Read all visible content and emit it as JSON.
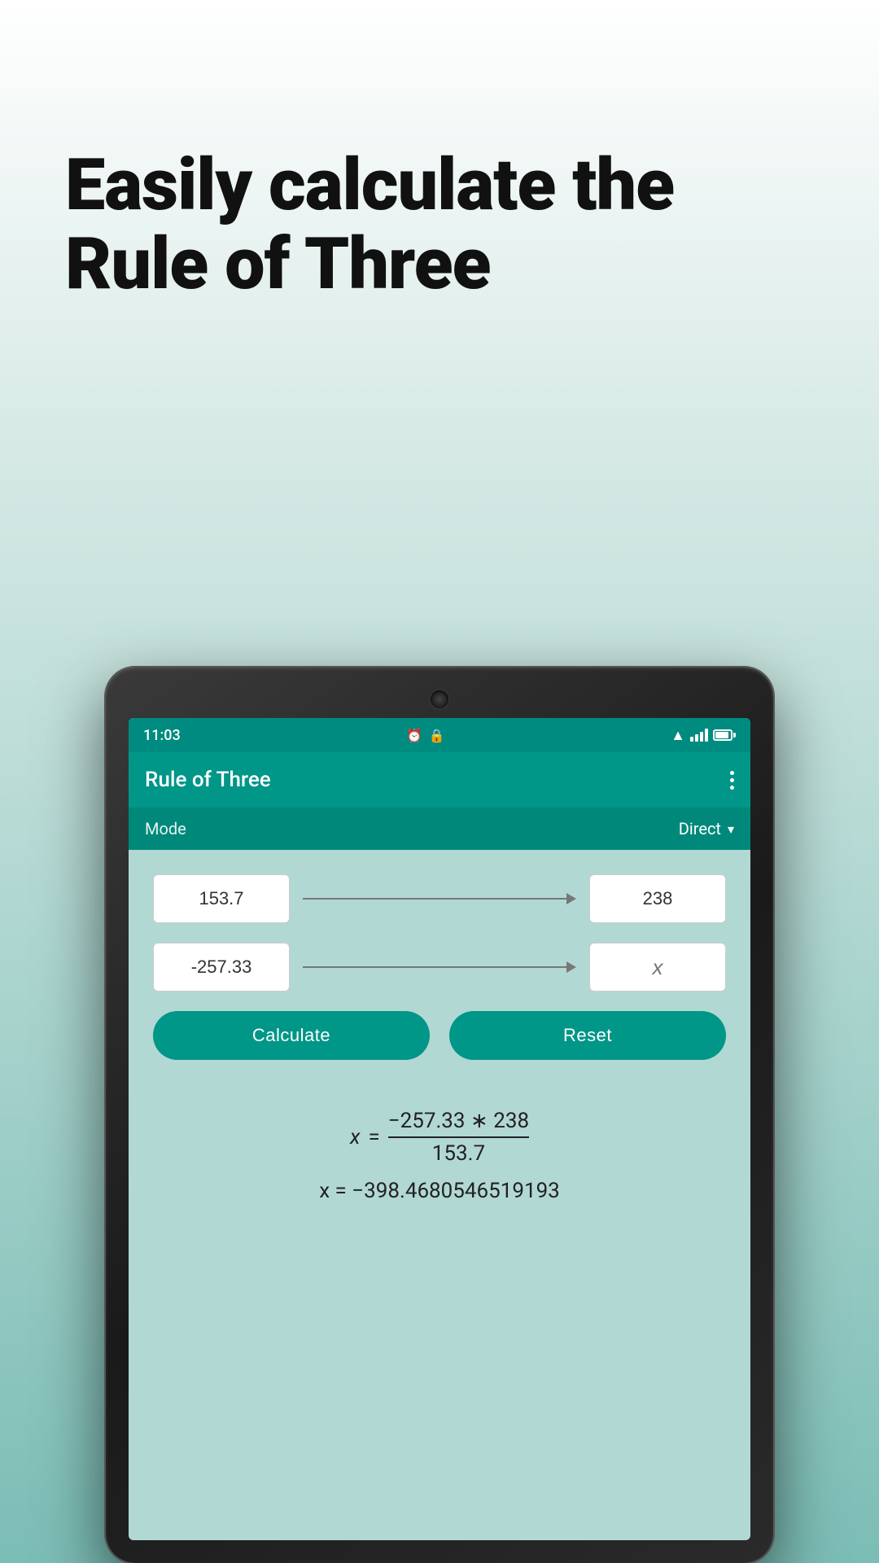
{
  "promo": {
    "title_line1": "Easily calculate the",
    "title_line2": "Rule of Three"
  },
  "status_bar": {
    "time": "11:03",
    "icons": [
      "alarm-icon",
      "lock-icon"
    ]
  },
  "app_bar": {
    "title": "Rule of Three",
    "more_icon_label": "more-options-icon"
  },
  "mode_bar": {
    "label": "Mode",
    "value": "Direct",
    "dropdown_arrow": "▾"
  },
  "calculator": {
    "input_a_value": "153.7",
    "input_b_value": "238",
    "input_c_value": "-257.33",
    "input_x_placeholder": "x",
    "calculate_button": "Calculate",
    "reset_button": "Reset",
    "formula_display": "x = −257.33 * 238 / 153.7",
    "formula_numerator": "−257.33 ∗ 238",
    "formula_denominator": "153.7",
    "result_label": "x = −398.4680546519193"
  }
}
